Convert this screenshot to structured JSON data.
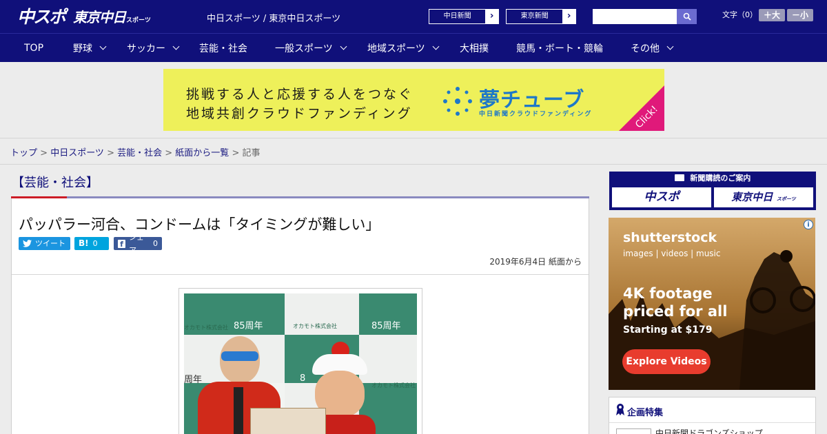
{
  "header": {
    "logo_main": "中スポ",
    "logo_sub": "東京中日",
    "logo_small": "スポーツ",
    "site_name": "中日スポーツ / 東京中日スポーツ",
    "link_chunichi": "中日新聞",
    "link_tokyo": "東京新聞",
    "search_placeholder": "",
    "font_label": "文字（0）",
    "font_big": "＋大",
    "font_small": "－小"
  },
  "nav": {
    "items": [
      {
        "label": "TOP"
      },
      {
        "label": "野球"
      },
      {
        "label": "サッカー"
      },
      {
        "label": "芸能・社会"
      },
      {
        "label": "一般スポーツ"
      },
      {
        "label": "地域スポーツ"
      },
      {
        "label": "大相撲"
      },
      {
        "label": "競馬・ボート・競輪"
      },
      {
        "label": "その他"
      }
    ]
  },
  "banner": {
    "line1": "挑戦する人と応援する人をつなぐ",
    "line2": "地域共創クラウドファンディング",
    "brand": "夢チューブ",
    "brand_sub": "中日新聞クラウドファンディング",
    "click": "Click!"
  },
  "breadcrumb": {
    "top": "トップ",
    "chunichi": "中日スポーツ",
    "geinou": "芸能・社会",
    "list": "紙面から一覧",
    "current": "記事"
  },
  "category": "【芸能・社会】",
  "article": {
    "title": "パッパラー河合、コンドームは「タイミングが難しい」",
    "tweet": "ツイート",
    "hatena": "B!",
    "hatena_count": "0",
    "facebook": "シェア",
    "facebook_count": "0",
    "date": "2019年6月4日 紙面から",
    "photo_text_1": "85周年",
    "photo_text_2": "85周年",
    "photo_text_3": "周年",
    "photo_text_4": "8",
    "photo_brand_1": "オカモト株式会社",
    "photo_brand_2": "オカモト株式会社",
    "photo_brand_3": "オカモト株式会社"
  },
  "sidebar": {
    "subscribe_title": "新聞購読のご案内",
    "sub_chuspo": "中スポ",
    "sub_tokyo": "東京中日",
    "sub_tokyo_small": "スポーツ",
    "ad": {
      "brand": "shutterstock",
      "sub": "images  |  videos  |  music",
      "headline1": "4K footage",
      "headline2": "priced for all",
      "price": "Starting at $179",
      "button": "Explore Videos"
    },
    "feature_title": "企画特集",
    "feature_item": "中日新聞ドラゴンズショップ"
  },
  "colors": {
    "header_bg": "#10107a",
    "accent_red": "#cc1c26",
    "link": "#1a1a80"
  }
}
